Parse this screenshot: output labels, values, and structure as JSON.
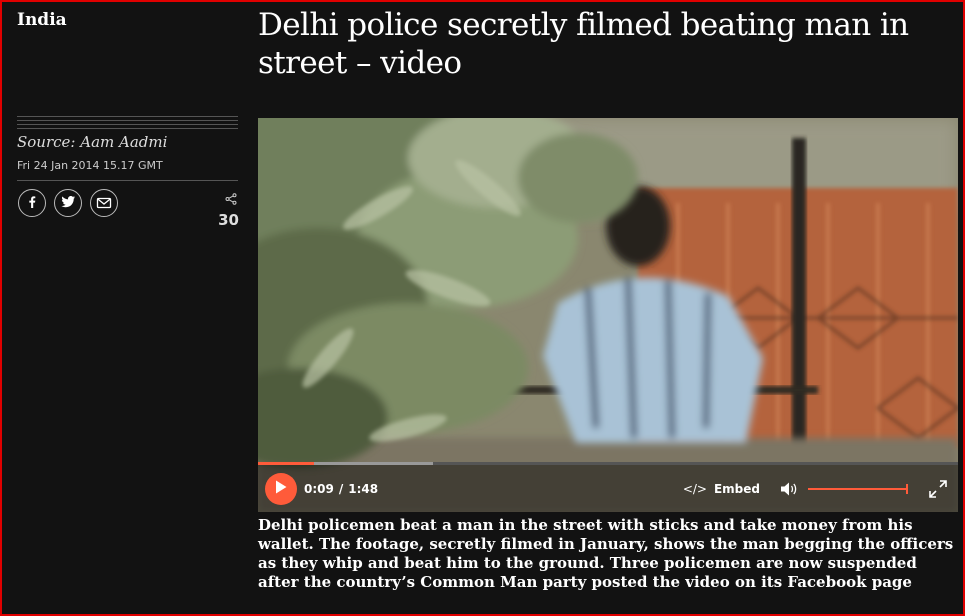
{
  "section": "India",
  "headline": "Delhi police secretly filmed beating man in street – video",
  "source": "Source: Aam Aadmi",
  "dateline": "Fri 24 Jan 2014 15.17 GMT",
  "share": {
    "count": "30",
    "icons": [
      "facebook-icon",
      "twitter-icon",
      "email-icon",
      "share-icon"
    ]
  },
  "player": {
    "current_time": "0:09",
    "separator": "/",
    "duration": "1:48",
    "progress": 0.08,
    "buffered": 0.25,
    "embed_label": "Embed",
    "embed_code_glyph": "</>",
    "volume": 1.0,
    "accent": "#ff5b3a"
  },
  "caption": "Delhi policemen beat a man in the street with sticks and take money from his wallet. The footage, secretly filmed in January, shows the man begging the officers as they whip and beat him to the ground. Three policemen are now suspended after the country’s Common Man party posted the video on its Facebook page",
  "colors": {
    "frame_border": "#e00000",
    "background": "#121212"
  }
}
